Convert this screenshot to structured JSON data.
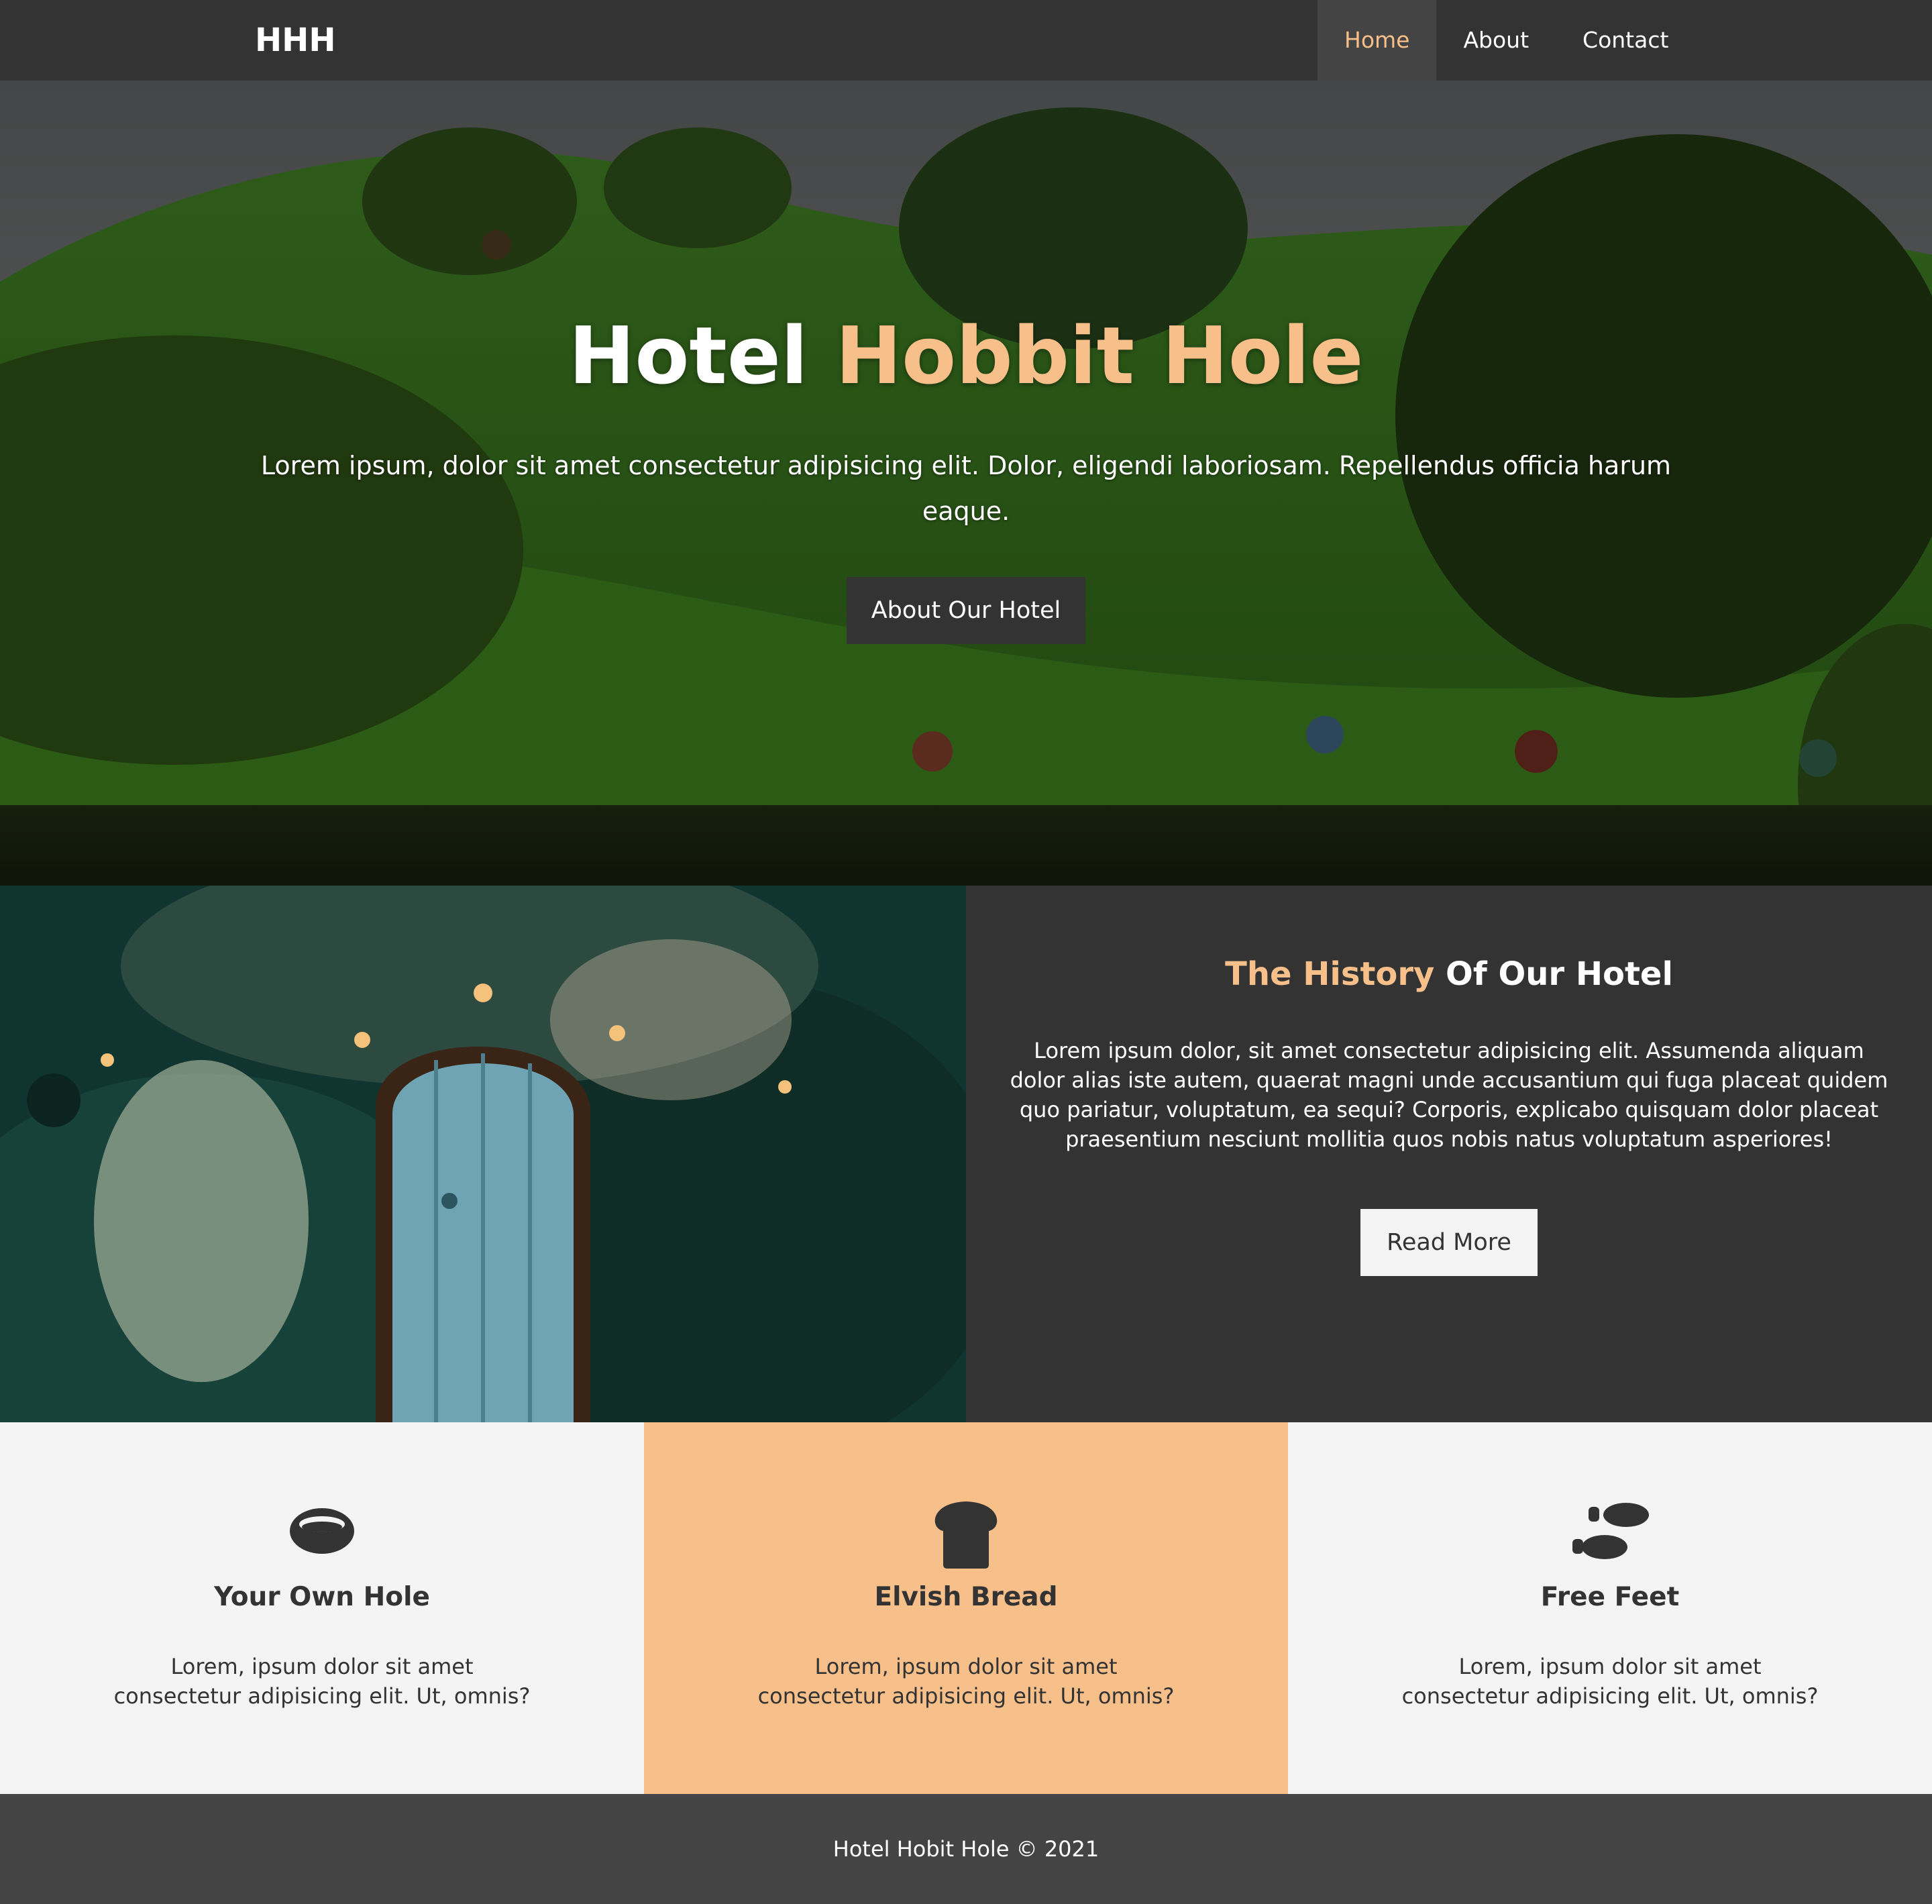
{
  "navbar": {
    "logo": "HHH",
    "links": [
      {
        "label": "Home",
        "active": true
      },
      {
        "label": "About",
        "active": false
      },
      {
        "label": "Contact",
        "active": false
      }
    ]
  },
  "hero": {
    "title_plain": "Hotel ",
    "title_accent": "Hobbit Hole",
    "text": "Lorem ipsum, dolor sit amet consectetur adipisicing elit. Dolor, eligendi laboriosam. Repellendus officia harum eaque.",
    "button_label": "About Our Hotel"
  },
  "about": {
    "title_accent": "The History",
    "title_plain": " Of Our Hotel",
    "text": "Lorem ipsum dolor, sit amet consectetur adipisicing elit. Assumenda aliquam dolor alias iste autem, quaerat magni unde accusantium qui fuga placeat quidem quo pariatur, voluptatum, ea sequi? Corporis, explicabo quisquam dolor placeat praesentium nesciunt mollitia quos nobis natus voluptatum asperiores!",
    "button_label": "Read More"
  },
  "features": [
    {
      "icon": "ring-icon",
      "title": "Your Own Hole",
      "text": "Lorem, ipsum dolor sit amet consectetur adipisicing elit. Ut, omnis?"
    },
    {
      "icon": "bread-icon",
      "title": "Elvish Bread",
      "text": "Lorem, ipsum dolor sit amet consectetur adipisicing elit. Ut, omnis?"
    },
    {
      "icon": "footprints-icon",
      "title": "Free Feet",
      "text": "Lorem, ipsum dolor sit amet consectetur adipisicing elit. Ut, omnis?"
    }
  ],
  "footer": {
    "text": "Hotel Hobit Hole © 2021"
  },
  "colors": {
    "accent": "#f7c08a",
    "dark": "#333333",
    "light": "#f4f4f4",
    "footer": "#444444"
  }
}
